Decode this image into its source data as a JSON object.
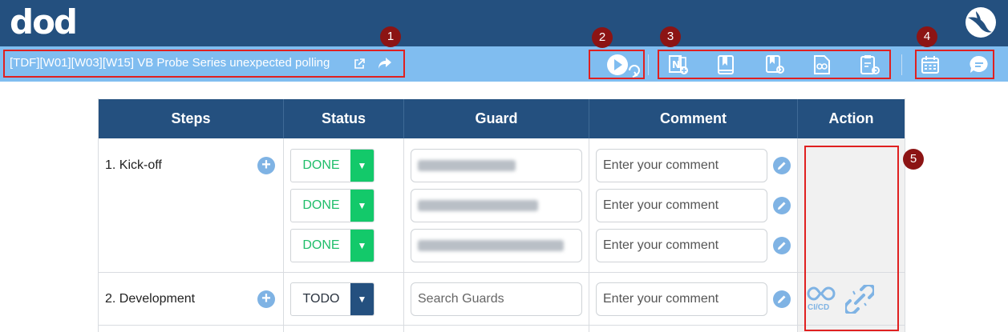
{
  "header": {
    "logo_text": "dod",
    "brand_color": "#24507f",
    "toolbar_color": "#80bdf0"
  },
  "document": {
    "title": "[TDF][W01][W03][W15] VB Probe Series unexpected polling"
  },
  "annotations": {
    "badge_1": "1",
    "badge_2": "2",
    "badge_3": "3",
    "badge_4": "4",
    "badge_5": "5"
  },
  "toolbar": {
    "icons": [
      "external-link-icon",
      "share-icon",
      "play-refresh-icon",
      "onenote-icon",
      "book-icon",
      "book-settings-icon",
      "document-link-icon",
      "clipboard-settings-icon",
      "calendar-icon",
      "chat-icon"
    ]
  },
  "table": {
    "headers": {
      "steps": "Steps",
      "status": "Status",
      "guard": "Guard",
      "comment": "Comment",
      "action": "Action"
    },
    "rows": [
      {
        "step": "1. Kick-off",
        "entries": [
          {
            "status": "DONE",
            "comment_placeholder": "Enter your comment"
          },
          {
            "status": "DONE",
            "comment_placeholder": "Enter your comment"
          },
          {
            "status": "DONE",
            "comment_placeholder": "Enter your comment"
          }
        ]
      },
      {
        "step": "2. Development",
        "entries": [
          {
            "status": "TODO",
            "guard_placeholder": "Search Guards",
            "comment_placeholder": "Enter your comment"
          }
        ],
        "actions": {
          "cicd_label": "CI/CD"
        }
      }
    ]
  }
}
